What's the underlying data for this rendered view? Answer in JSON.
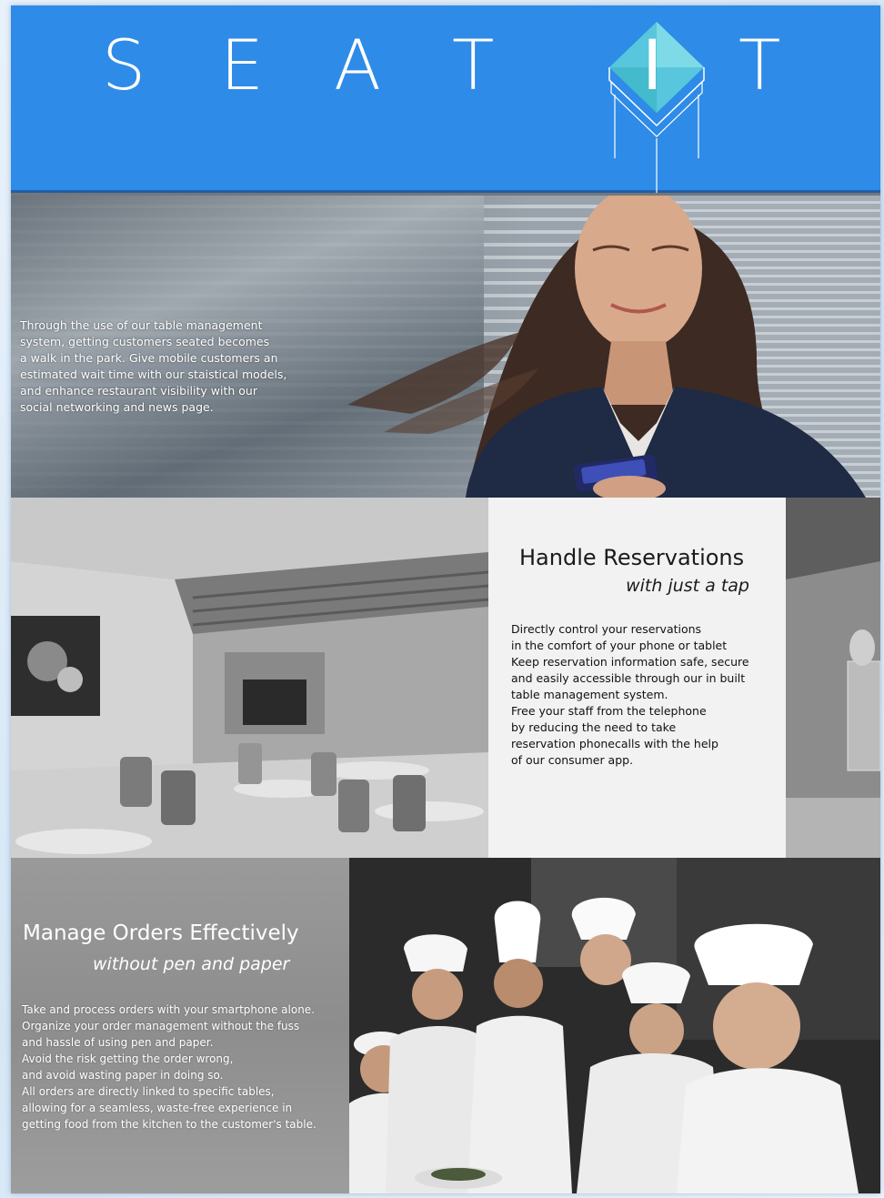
{
  "header": {
    "logo_letters": [
      "S",
      "E",
      "A",
      "T",
      "I",
      "T"
    ],
    "background_color": "#2f8be8",
    "logo_mark_icon": "cube-icon"
  },
  "hero": {
    "lines": [
      "Through the use of our table management",
      "system, getting customers seated becomes",
      "a walk in the park. Give mobile customers an",
      "estimated wait time with our staistical models,",
      "and enhance restaurant visibility with our",
      "social networking and news page."
    ],
    "image": "woman-with-phone-photo"
  },
  "reservations": {
    "title": "Handle Reservations",
    "subtitle": "with just a tap",
    "lines": [
      "Directly control your reservations",
      "in the comfort of your phone or tablet",
      "Keep reservation information safe, secure",
      "and easily accessible through our in built",
      "table management system.",
      "Free your staff from the telephone",
      "by reducing the need to take",
      "reservation phonecalls with the help",
      "of our consumer app."
    ],
    "image": "restaurant-interior-photo"
  },
  "orders": {
    "title": "Manage Orders Effectively",
    "subtitle": "without pen and paper",
    "lines": [
      "Take and process orders with your smartphone alone.",
      "Organize your order management without the fuss",
      "and hassle of using pen and paper.",
      "Avoid the risk getting the order wrong,",
      "and avoid wasting paper in doing so.",
      "All orders are directly linked to specific tables,",
      "allowing for a seamless, waste-free experience in",
      "getting food from the kitchen to the customer's table."
    ],
    "image": "chefs-group-photo"
  }
}
